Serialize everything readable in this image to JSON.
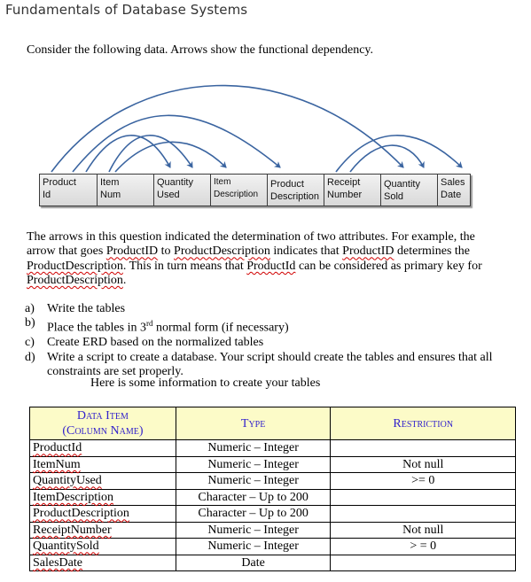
{
  "header": {
    "title": "Fundamentals of Database Systems"
  },
  "intro": "Consider the following data. Arrows show the functional dependency.",
  "diagram": {
    "arrow_color": "#3a64a0",
    "attributes": [
      {
        "line1": "Product",
        "line2": "Id"
      },
      {
        "line1": "Item",
        "line2": "Num"
      },
      {
        "line1": "Quantity",
        "line2": "Used"
      },
      {
        "line1": "Item",
        "line2": "Description"
      },
      {
        "line1": "Product",
        "line2": "Description"
      },
      {
        "line1": "Receipt",
        "line2": "Number"
      },
      {
        "line1": "Quantity",
        "line2": "Sold"
      },
      {
        "line1": "Sales",
        "line2": "Date"
      }
    ],
    "dependencies": [
      {
        "from": "Product Id",
        "to": "Quantity Sold"
      },
      {
        "from": "Product Id",
        "to": "Product Description"
      },
      {
        "from": "Product Id",
        "to": "Quantity Used"
      },
      {
        "from": "Item Num",
        "to": "Quantity Used"
      },
      {
        "from": "Item Num",
        "to": "Item Description"
      },
      {
        "from": "Receipt Number",
        "to": "Sales Date"
      },
      {
        "from": "Receipt Number",
        "to": "Quantity Sold"
      }
    ]
  },
  "paragraph": {
    "p1": "The arrows in this question indicated the determination of two attributes. For example, the arrow that goes ",
    "w1": "ProductID",
    "p2": "  to ",
    "w2": "ProductDescription",
    "p3": " indicates that ",
    "w3": "ProductID",
    "p4": " determines the ",
    "w4": "ProductDescription",
    "p5": ".  This in turn means that ",
    "w5": "ProductId",
    "p6": " can be considered as primary key for ",
    "w6": "ProductDescription",
    "p7": "."
  },
  "tasks": [
    {
      "label": "a)",
      "text": "Write the tables"
    },
    {
      "label": "b)",
      "text_before": "Place the tables in 3",
      "sup": "rd",
      "text_after": " normal form (if necessary)"
    },
    {
      "label": "c)",
      "text": "Create ERD based on the normalized tables"
    },
    {
      "label": "d)",
      "text": "Write a script to create a database. Your script should create the tables and ensures that all constraints are set properly."
    }
  ],
  "note": "Here is some information to create your tables",
  "table": {
    "header_line1": "Data Item",
    "header_line2": "(Column Name)",
    "header_type": "Type",
    "header_restriction": "Restriction",
    "rows": [
      {
        "name": "ProductId",
        "type": "Numeric – Integer",
        "restriction": ""
      },
      {
        "name": "ItemNum",
        "type": "Numeric – Integer",
        "restriction": "Not null"
      },
      {
        "name": "QuantityUsed",
        "type": "Numeric – Integer",
        "restriction": ">= 0"
      },
      {
        "name": "ItemDescription",
        "type": "Character – Up to 200",
        "restriction": ""
      },
      {
        "name": "ProductDescription",
        "type": "Character – Up to 200",
        "restriction": ""
      },
      {
        "name": "ReceiptNumber",
        "type": "Numeric – Integer",
        "restriction": "Not null"
      },
      {
        "name": "QuantitySold",
        "type": "Numeric – Integer",
        "restriction": "> = 0"
      },
      {
        "name": "SalesDate",
        "type": "Date",
        "restriction": ""
      }
    ]
  }
}
